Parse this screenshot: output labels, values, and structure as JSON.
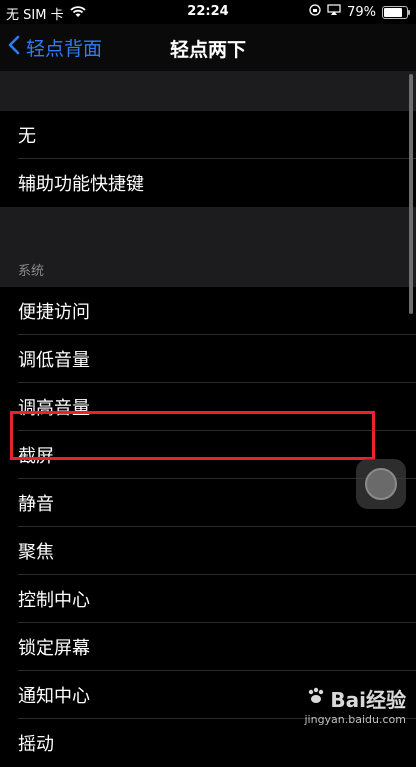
{
  "status_bar": {
    "carrier": "无 SIM 卡",
    "time": "22:24",
    "battery": "79%"
  },
  "nav": {
    "back_label": "轻点背面",
    "title": "轻点两下"
  },
  "list": {
    "group1": [
      "无",
      "辅助功能快捷键"
    ],
    "section_header": "系统",
    "group2": [
      "便捷访问",
      "调低音量",
      "调高音量",
      "截屏",
      "静音",
      "聚焦",
      "控制中心",
      "锁定屏幕",
      "通知中心",
      "摇动"
    ]
  },
  "watermark": {
    "brand": "Bai经验",
    "url": "jingyan.baidu.com"
  },
  "colors": {
    "accent": "#2f7cf6",
    "highlight": "#e8242b"
  }
}
